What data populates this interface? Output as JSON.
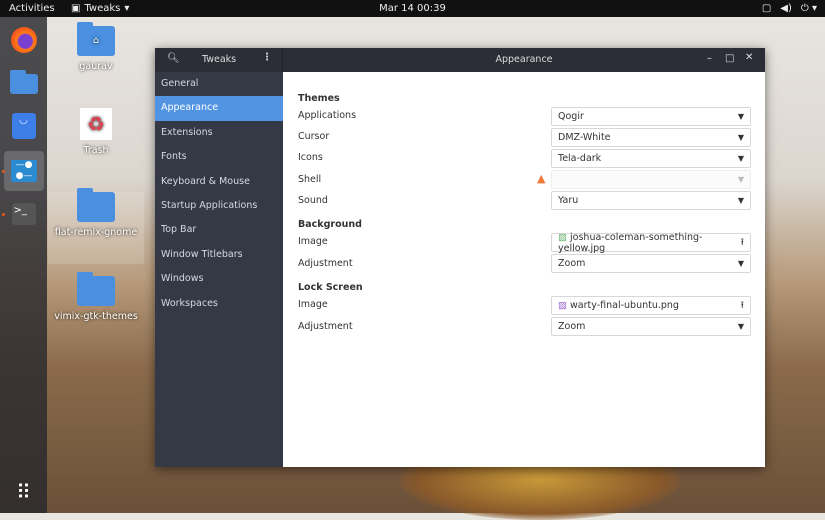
{
  "topbar": {
    "activities": "Activities",
    "app": "Tweaks",
    "clock": "Mar 14  00:39"
  },
  "desktop": {
    "icons": [
      "gaurav",
      "Trash",
      "flat-remix-gnome",
      "vimix-gtk-themes"
    ]
  },
  "window": {
    "sidebar_title": "Tweaks",
    "title": "Appearance",
    "sidebar": [
      "General",
      "Appearance",
      "Extensions",
      "Fonts",
      "Keyboard & Mouse",
      "Startup Applications",
      "Top Bar",
      "Window Titlebars",
      "Windows",
      "Workspaces"
    ],
    "sections": {
      "themes": {
        "title": "Themes",
        "applications_label": "Applications",
        "applications": "Qogir",
        "cursor_label": "Cursor",
        "cursor": "DMZ-White",
        "icons_label": "Icons",
        "icons": "Tela-dark",
        "shell_label": "Shell",
        "shell": "",
        "sound_label": "Sound",
        "sound": "Yaru"
      },
      "background": {
        "title": "Background",
        "image_label": "Image",
        "image": "joshua-coleman-something-yellow.jpg",
        "adjustment_label": "Adjustment",
        "adjustment": "Zoom"
      },
      "lock": {
        "title": "Lock Screen",
        "image_label": "Image",
        "image": "warty-final-ubuntu.png",
        "adjustment_label": "Adjustment",
        "adjustment": "Zoom"
      }
    }
  },
  "colors": {
    "accent": "#5294e2",
    "sidebar": "#353945",
    "warning": "#f27835"
  }
}
